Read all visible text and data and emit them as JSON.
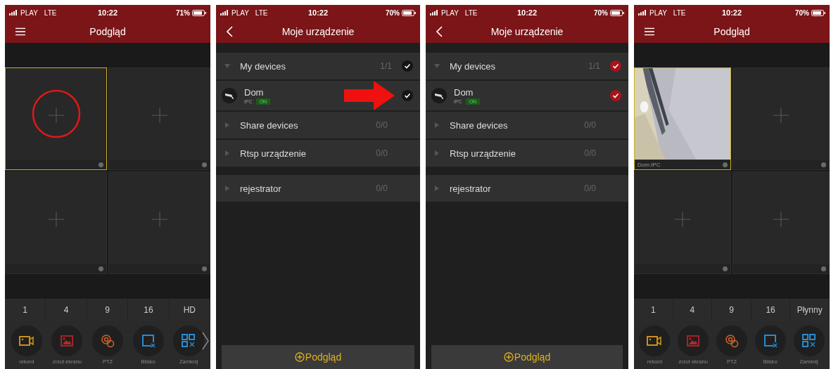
{
  "screens": [
    {
      "kind": "preview",
      "status": {
        "carrier": "PLAY",
        "network": "LTE",
        "time": "10:22",
        "battery": "71%"
      },
      "title": "Podgląd",
      "cells": [
        {
          "selected": true,
          "circled": true
        },
        {
          "selected": false,
          "circled": false
        },
        {
          "selected": false,
          "circled": false
        },
        {
          "selected": false,
          "circled": false
        }
      ],
      "layouts": [
        "1",
        "4",
        "9",
        "16",
        "HD"
      ],
      "tools": [
        {
          "label": "rekord",
          "color": "#c8901c"
        },
        {
          "label": "zrzut ekranu",
          "color": "#c0262a"
        },
        {
          "label": "PTZ",
          "color": "#d0602a"
        },
        {
          "label": "Blisko",
          "color": "#2a8ad0"
        },
        {
          "label": "Zamknij",
          "color": "#2a8ad0"
        }
      ],
      "more_arrow": true
    },
    {
      "kind": "devices",
      "status": {
        "carrier": "PLAY",
        "network": "LTE",
        "time": "10:22",
        "battery": "70%"
      },
      "title": "Moje urządzenie",
      "pointer_arrow": true,
      "sections": [
        [
          {
            "label": "My devices",
            "count": "1/1",
            "expanded": true,
            "select": {
              "checked": false
            },
            "children": [
              {
                "name": "Dom",
                "type": "IPC",
                "status": "ON",
                "select": {
                  "checked": false
                }
              }
            ]
          },
          {
            "label": "Share devices",
            "count": "0/0",
            "expanded": false
          },
          {
            "label": "Rtsp urządzenie",
            "count": "0/0",
            "expanded": false
          }
        ],
        [
          {
            "label": "rejestrator",
            "count": "0/0",
            "expanded": false
          }
        ]
      ],
      "button": "Podgląd"
    },
    {
      "kind": "devices",
      "status": {
        "carrier": "PLAY",
        "network": "LTE",
        "time": "10:22",
        "battery": "70%"
      },
      "title": "Moje urządzenie",
      "pointer_arrow": false,
      "sections": [
        [
          {
            "label": "My devices",
            "count": "1/1",
            "expanded": true,
            "select": {
              "checked": true
            },
            "children": [
              {
                "name": "Dom",
                "type": "IPC",
                "status": "ON",
                "select": {
                  "checked": true
                }
              }
            ]
          },
          {
            "label": "Share devices",
            "count": "0/0",
            "expanded": false
          },
          {
            "label": "Rtsp urządzenie",
            "count": "0/0",
            "expanded": false
          }
        ],
        [
          {
            "label": "rejestrator",
            "count": "0/0",
            "expanded": false
          }
        ]
      ],
      "button": "Podgląd"
    },
    {
      "kind": "preview",
      "status": {
        "carrier": "PLAY",
        "network": "LTE",
        "time": "10:22",
        "battery": "70%"
      },
      "title": "Podgląd",
      "cells": [
        {
          "selected": true,
          "circled": false,
          "kind": "picture",
          "caption": "Dom.IPC"
        },
        {
          "selected": false,
          "circled": false
        },
        {
          "selected": false,
          "circled": false
        },
        {
          "selected": false,
          "circled": false
        }
      ],
      "layouts": [
        "1",
        "4",
        "9",
        "16",
        "Płynny"
      ],
      "tools": [
        {
          "label": "rekord",
          "color": "#c8901c"
        },
        {
          "label": "zrzut ekranu",
          "color": "#c0262a"
        },
        {
          "label": "PTZ",
          "color": "#d0602a"
        },
        {
          "label": "Blisko",
          "color": "#2a8ad0"
        },
        {
          "label": "Zamknij",
          "color": "#2a8ad0"
        }
      ],
      "more_arrow": false
    }
  ]
}
